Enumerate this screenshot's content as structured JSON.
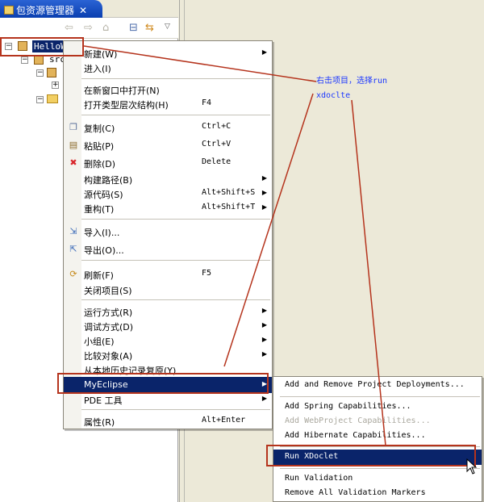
{
  "view": {
    "tab_title": "包资源管理器",
    "close_glyph": "✕",
    "toolbar_icons": [
      "back-arrow-icon",
      "forward-arrow-icon",
      "home-icon",
      "collapse-all-icon",
      "link-with-editor-icon",
      "view-menu-icon"
    ]
  },
  "tree": {
    "project_label": "HelloW",
    "src_label": "src"
  },
  "context_menu": {
    "items": [
      {
        "label": "新建(W)",
        "submenu": true
      },
      {
        "label": "进入(I)"
      },
      {
        "label": "在新窗口中打开(N)"
      },
      {
        "label": "打开类型层次结构(H)",
        "shortcut": "F4"
      },
      {
        "label": "复制(C)",
        "shortcut": "Ctrl+C",
        "icon": "copy-icon"
      },
      {
        "label": "粘贴(P)",
        "shortcut": "Ctrl+V",
        "icon": "paste-icon"
      },
      {
        "label": "删除(D)",
        "shortcut": "Delete",
        "icon": "delete-icon"
      },
      {
        "label": "构建路径(B)",
        "submenu": true
      },
      {
        "label": "源代码(S)",
        "shortcut": "Alt+Shift+S",
        "submenu": true
      },
      {
        "label": "重构(T)",
        "shortcut": "Alt+Shift+T",
        "submenu": true
      },
      {
        "label": "导入(I)...",
        "icon": "import-icon"
      },
      {
        "label": "导出(O)...",
        "icon": "export-icon"
      },
      {
        "label": "刷新(F)",
        "shortcut": "F5",
        "icon": "refresh-icon"
      },
      {
        "label": "关闭项目(S)"
      },
      {
        "label": "运行方式(R)",
        "submenu": true
      },
      {
        "label": "调试方式(D)",
        "submenu": true
      },
      {
        "label": "小组(E)",
        "submenu": true
      },
      {
        "label": "比较对象(A)",
        "submenu": true
      },
      {
        "label": "从本地历史记录复原(Y)"
      },
      {
        "label": "MyEclipse",
        "submenu": true,
        "selected": true
      },
      {
        "label": "PDE 工具",
        "submenu": true
      },
      {
        "label": "属性(R)",
        "shortcut": "Alt+Enter"
      }
    ]
  },
  "submenu": {
    "items": [
      {
        "label": "Add and Remove Project Deployments..."
      },
      {
        "label": "Add Spring Capabilities..."
      },
      {
        "label": "Add WebProject Capabilities...",
        "disabled": true
      },
      {
        "label": "Add Hibernate Capabilities..."
      },
      {
        "label": "Run XDoclet",
        "selected": true
      },
      {
        "label": "Run Validation"
      },
      {
        "label": "Remove All Validation Markers"
      }
    ]
  },
  "annotation": {
    "line1": "右击项目，选择run",
    "line2": "xdoclte",
    "color": "#b5341d",
    "text_color": "#1c38ff"
  },
  "colors": {
    "selection": "#0a246a",
    "tab_active": "#0a3fb0"
  }
}
